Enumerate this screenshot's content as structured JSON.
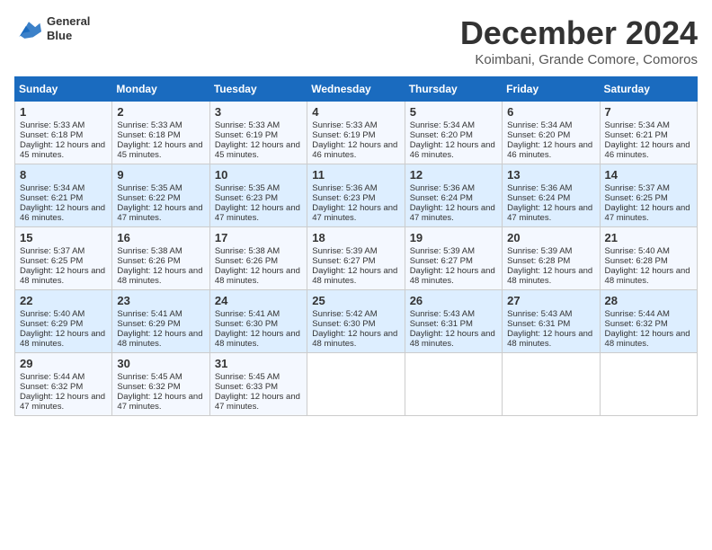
{
  "header": {
    "logo_line1": "General",
    "logo_line2": "Blue",
    "month_title": "December 2024",
    "subtitle": "Koimbani, Grande Comore, Comoros"
  },
  "days_of_week": [
    "Sunday",
    "Monday",
    "Tuesday",
    "Wednesday",
    "Thursday",
    "Friday",
    "Saturday"
  ],
  "weeks": [
    [
      {
        "day": 1,
        "sunrise": "5:33 AM",
        "sunset": "6:18 PM",
        "daylight": "12 hours and 45 minutes."
      },
      {
        "day": 2,
        "sunrise": "5:33 AM",
        "sunset": "6:18 PM",
        "daylight": "12 hours and 45 minutes."
      },
      {
        "day": 3,
        "sunrise": "5:33 AM",
        "sunset": "6:19 PM",
        "daylight": "12 hours and 45 minutes."
      },
      {
        "day": 4,
        "sunrise": "5:33 AM",
        "sunset": "6:19 PM",
        "daylight": "12 hours and 46 minutes."
      },
      {
        "day": 5,
        "sunrise": "5:34 AM",
        "sunset": "6:20 PM",
        "daylight": "12 hours and 46 minutes."
      },
      {
        "day": 6,
        "sunrise": "5:34 AM",
        "sunset": "6:20 PM",
        "daylight": "12 hours and 46 minutes."
      },
      {
        "day": 7,
        "sunrise": "5:34 AM",
        "sunset": "6:21 PM",
        "daylight": "12 hours and 46 minutes."
      }
    ],
    [
      {
        "day": 8,
        "sunrise": "5:34 AM",
        "sunset": "6:21 PM",
        "daylight": "12 hours and 46 minutes."
      },
      {
        "day": 9,
        "sunrise": "5:35 AM",
        "sunset": "6:22 PM",
        "daylight": "12 hours and 47 minutes."
      },
      {
        "day": 10,
        "sunrise": "5:35 AM",
        "sunset": "6:23 PM",
        "daylight": "12 hours and 47 minutes."
      },
      {
        "day": 11,
        "sunrise": "5:36 AM",
        "sunset": "6:23 PM",
        "daylight": "12 hours and 47 minutes."
      },
      {
        "day": 12,
        "sunrise": "5:36 AM",
        "sunset": "6:24 PM",
        "daylight": "12 hours and 47 minutes."
      },
      {
        "day": 13,
        "sunrise": "5:36 AM",
        "sunset": "6:24 PM",
        "daylight": "12 hours and 47 minutes."
      },
      {
        "day": 14,
        "sunrise": "5:37 AM",
        "sunset": "6:25 PM",
        "daylight": "12 hours and 47 minutes."
      }
    ],
    [
      {
        "day": 15,
        "sunrise": "5:37 AM",
        "sunset": "6:25 PM",
        "daylight": "12 hours and 48 minutes."
      },
      {
        "day": 16,
        "sunrise": "5:38 AM",
        "sunset": "6:26 PM",
        "daylight": "12 hours and 48 minutes."
      },
      {
        "day": 17,
        "sunrise": "5:38 AM",
        "sunset": "6:26 PM",
        "daylight": "12 hours and 48 minutes."
      },
      {
        "day": 18,
        "sunrise": "5:39 AM",
        "sunset": "6:27 PM",
        "daylight": "12 hours and 48 minutes."
      },
      {
        "day": 19,
        "sunrise": "5:39 AM",
        "sunset": "6:27 PM",
        "daylight": "12 hours and 48 minutes."
      },
      {
        "day": 20,
        "sunrise": "5:39 AM",
        "sunset": "6:28 PM",
        "daylight": "12 hours and 48 minutes."
      },
      {
        "day": 21,
        "sunrise": "5:40 AM",
        "sunset": "6:28 PM",
        "daylight": "12 hours and 48 minutes."
      }
    ],
    [
      {
        "day": 22,
        "sunrise": "5:40 AM",
        "sunset": "6:29 PM",
        "daylight": "12 hours and 48 minutes."
      },
      {
        "day": 23,
        "sunrise": "5:41 AM",
        "sunset": "6:29 PM",
        "daylight": "12 hours and 48 minutes."
      },
      {
        "day": 24,
        "sunrise": "5:41 AM",
        "sunset": "6:30 PM",
        "daylight": "12 hours and 48 minutes."
      },
      {
        "day": 25,
        "sunrise": "5:42 AM",
        "sunset": "6:30 PM",
        "daylight": "12 hours and 48 minutes."
      },
      {
        "day": 26,
        "sunrise": "5:43 AM",
        "sunset": "6:31 PM",
        "daylight": "12 hours and 48 minutes."
      },
      {
        "day": 27,
        "sunrise": "5:43 AM",
        "sunset": "6:31 PM",
        "daylight": "12 hours and 48 minutes."
      },
      {
        "day": 28,
        "sunrise": "5:44 AM",
        "sunset": "6:32 PM",
        "daylight": "12 hours and 48 minutes."
      }
    ],
    [
      {
        "day": 29,
        "sunrise": "5:44 AM",
        "sunset": "6:32 PM",
        "daylight": "12 hours and 47 minutes."
      },
      {
        "day": 30,
        "sunrise": "5:45 AM",
        "sunset": "6:32 PM",
        "daylight": "12 hours and 47 minutes."
      },
      {
        "day": 31,
        "sunrise": "5:45 AM",
        "sunset": "6:33 PM",
        "daylight": "12 hours and 47 minutes."
      },
      null,
      null,
      null,
      null
    ]
  ]
}
